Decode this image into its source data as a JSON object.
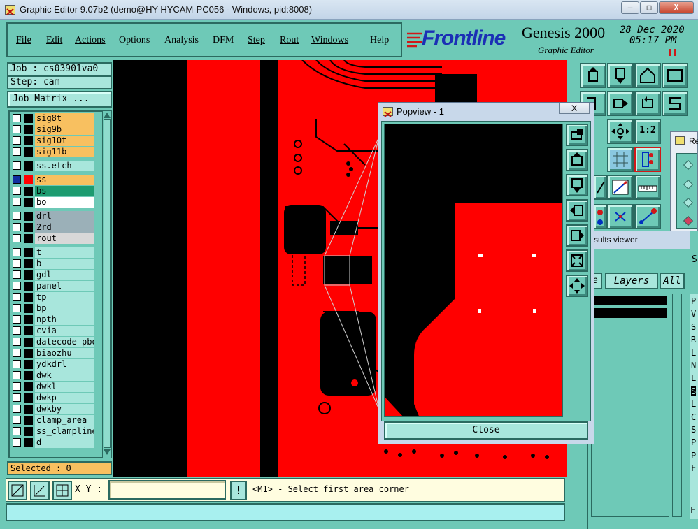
{
  "window": {
    "title": "Graphic Editor 9.07b2 (demo@HY-HYCAM-PC056 - Windows, pid:8008)",
    "btn_min": "—",
    "btn_max": "□",
    "btn_close": "X"
  },
  "menu": {
    "file": "File",
    "edit": "Edit",
    "actions": "Actions",
    "options": "Options",
    "analysis": "Analysis",
    "dfm": "DFM",
    "step": "Step",
    "rout": "Rout",
    "windows": "Windows",
    "help": "Help"
  },
  "banner": {
    "brand": "Frontline",
    "product": "Genesis 2000",
    "subtitle": "Graphic Editor",
    "date": "28 Dec 2020",
    "time": "05:17 PM"
  },
  "job": {
    "job_label": "Job : cs03901va0",
    "step_label": "Step: cam",
    "matrix_button": "Job Matrix ..."
  },
  "layers": [
    {
      "name": "sig8t",
      "color": "#f8c060"
    },
    {
      "name": "sig9b",
      "color": "#f8c060"
    },
    {
      "name": "sig10t",
      "color": "#f8c060"
    },
    {
      "name": "sig11b",
      "color": "#f8c060"
    },
    {
      "name": "ss.etch",
      "color": "#a8e6dc"
    },
    {
      "name": "ss",
      "color": "#f8c060"
    },
    {
      "name": "bs",
      "color": "#1d9b70"
    },
    {
      "name": "bo",
      "color": "#ffffff"
    },
    {
      "name": "drl",
      "color": "#9bb0b8"
    },
    {
      "name": "2rd",
      "color": "#9bb0b8"
    },
    {
      "name": "rout",
      "color": "#d8d8d8"
    },
    {
      "name": "t",
      "color": "#a8e6dc"
    },
    {
      "name": "b",
      "color": "#a8e6dc"
    },
    {
      "name": "gdl",
      "color": "#a8e6dc"
    },
    {
      "name": "panel",
      "color": "#a8e6dc"
    },
    {
      "name": "tp",
      "color": "#a8e6dc"
    },
    {
      "name": "bp",
      "color": "#a8e6dc"
    },
    {
      "name": "npth",
      "color": "#a8e6dc"
    },
    {
      "name": "cvia",
      "color": "#a8e6dc"
    },
    {
      "name": "datecode-pbo",
      "color": "#a8e6dc"
    },
    {
      "name": "biaozhu",
      "color": "#a8e6dc"
    },
    {
      "name": "ydkdrl",
      "color": "#a8e6dc"
    },
    {
      "name": "dwk",
      "color": "#a8e6dc"
    },
    {
      "name": "dwkl",
      "color": "#a8e6dc"
    },
    {
      "name": "dwkp",
      "color": "#a8e6dc"
    },
    {
      "name": "dwkby",
      "color": "#a8e6dc"
    },
    {
      "name": "clamp_area",
      "color": "#a8e6dc"
    },
    {
      "name": "ss_clampline",
      "color": "#a8e6dc"
    },
    {
      "name": "d",
      "color": "#a8e6dc"
    }
  ],
  "selected": "Selected : 0",
  "popview": {
    "title": "Popview - 1",
    "close_button": "Close"
  },
  "results": {
    "title": "Re",
    "viewer_label": "sults viewer",
    "tab_layers": "Layers",
    "tab_all": "All",
    "side_tab": "S",
    "col_letters": [
      "P",
      "V",
      "S",
      "R",
      "L",
      "N",
      "L",
      "S",
      "L",
      "C",
      "S",
      "P",
      "P",
      "F"
    ],
    "bottom_letter": "F"
  },
  "bottom": {
    "xy_label": "X Y :",
    "xy_value": "",
    "bang": "!",
    "prompt": "<M1> - Select first area corner"
  },
  "colors": {
    "panel": "#6ec9b7",
    "copper": "#ff0000",
    "canvas": "#000000"
  }
}
